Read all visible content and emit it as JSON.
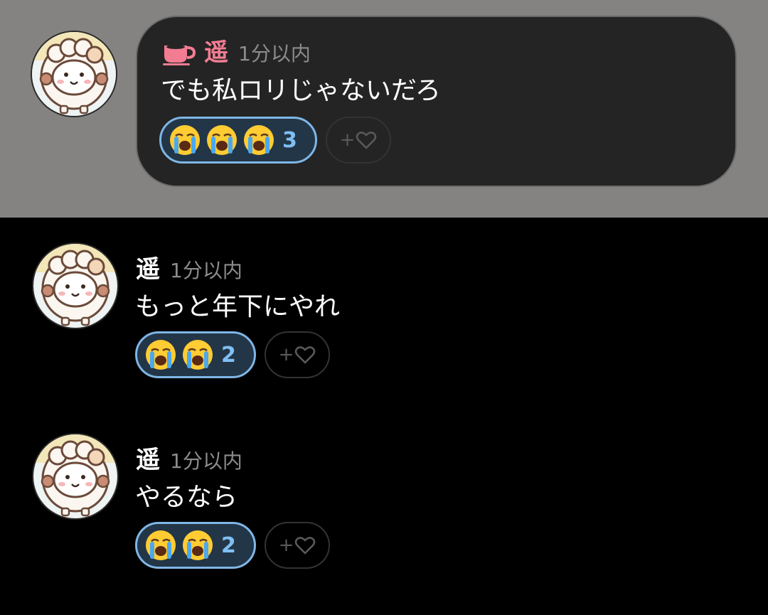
{
  "messages": [
    {
      "username": "遥",
      "timestamp": "1分以内",
      "text": "でも私ロリじゃないだろ",
      "reaction_emoji": "loudly-crying-face",
      "reaction_count": "3",
      "add_reaction_label": "+",
      "highlighted": true,
      "username_color": "#f27d93"
    },
    {
      "username": "遥",
      "timestamp": "1分以内",
      "text": "もっと年下にやれ",
      "reaction_emoji": "loudly-crying-face",
      "reaction_count": "2",
      "add_reaction_label": "+"
    },
    {
      "username": "遥",
      "timestamp": "1分以内",
      "text": "やるなら",
      "reaction_emoji": "loudly-crying-face",
      "reaction_count": "2",
      "add_reaction_label": "+"
    }
  ],
  "colors": {
    "highlight_band": "#858382",
    "bubble_bg": "#242424",
    "reaction_border": "#7fb6e6",
    "reaction_count": "#7fc0f4",
    "timestamp": "#8c8c8c"
  },
  "icons": {
    "status_icon": "coffee-cup-icon",
    "add_reaction_icon": "heart-outline-icon",
    "avatar": "sheep-character-avatar"
  }
}
